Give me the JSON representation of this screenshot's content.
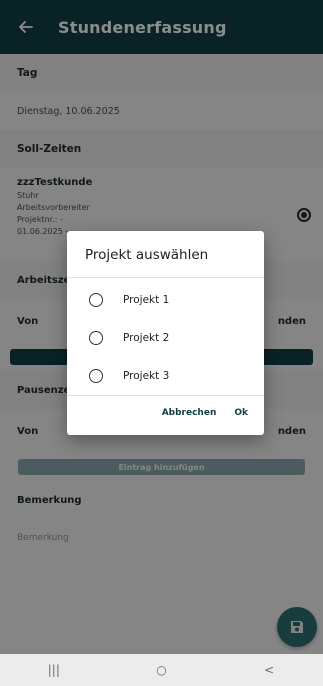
{
  "appbar": {
    "title": "Stundenerfassung",
    "back_icon": "arrow-left-icon"
  },
  "form": {
    "tag_label": "Tag",
    "date_value": "Dienstag, 10.06.2025",
    "soll_label": "Soll-Zeiten",
    "customer": {
      "name": "zzzTestkunde",
      "lines": [
        "Stuhr",
        "Arbeitsvorbereiter",
        "Projektnr.: -",
        "01.06.2025 -"
      ],
      "selected": true
    },
    "arbeitszeit_label": "Arbeitszeit",
    "von_label": "Von",
    "stunden_label": "nden",
    "pausenzeit_label": "Pausenzeit",
    "von2_label": "Von",
    "stunden2_label": "nden",
    "add_entry_label": "Eintrag hinzufügen",
    "bemerkung_label": "Bemerkung",
    "bemerkung_placeholder": "Bemerkung"
  },
  "fab": {
    "icon": "save-icon"
  },
  "navbar": {
    "recents_icon": "|||",
    "home_icon": "○",
    "back_icon": "<"
  },
  "dialog": {
    "title": "Projekt auswählen",
    "options": [
      {
        "label": "Projekt 1",
        "selected": false
      },
      {
        "label": "Projekt 2",
        "selected": false
      },
      {
        "label": "Projekt 3",
        "selected": false
      }
    ],
    "cancel_label": "Abbrechen",
    "ok_label": "Ok"
  },
  "colors": {
    "primary": "#0f3f45",
    "fab": "#2f6d72",
    "disabled_button": "#8ba7a9",
    "scrim": "rgba(0,0,0,0.45)"
  }
}
